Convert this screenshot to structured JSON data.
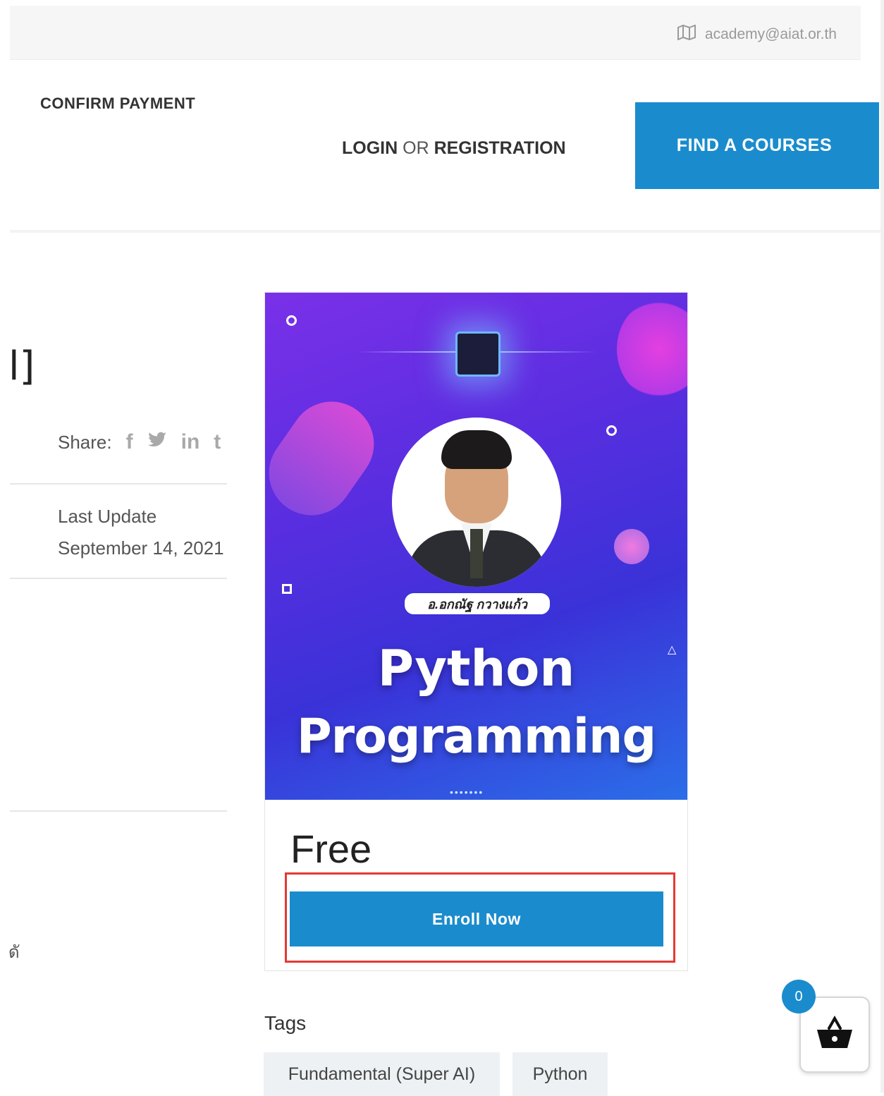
{
  "topbar": {
    "email": "academy@aiat.or.th",
    "email_icon": "map-icon"
  },
  "nav": {
    "confirm_payment": "CONFIRM PAYMENT",
    "login": "LOGIN",
    "or": "OR",
    "registration": "REGISTRATION",
    "find_courses": "FIND A COURSES"
  },
  "sidebar": {
    "title_fragment": "l]",
    "share_label": "Share:",
    "share_icons": [
      "facebook-icon",
      "twitter-icon",
      "linkedin-icon",
      "tumblr-icon"
    ],
    "last_update_label": "Last Update",
    "last_update_date": "September 14, 2021",
    "thai_fragment": "ดั"
  },
  "course_card": {
    "banner": {
      "instructor_name": "อ.อกณัฐ กวางแก้ว",
      "title_line1": "Python",
      "title_line2": "Programming"
    },
    "price": "Free",
    "enroll_label": "Enroll Now"
  },
  "tags": {
    "title": "Tags",
    "items": [
      "Fundamental (Super AI)",
      "Python"
    ]
  },
  "cart": {
    "count": "0",
    "icon": "basket-icon"
  },
  "colors": {
    "primary": "#1a8ccd",
    "highlight": "#e53935"
  }
}
